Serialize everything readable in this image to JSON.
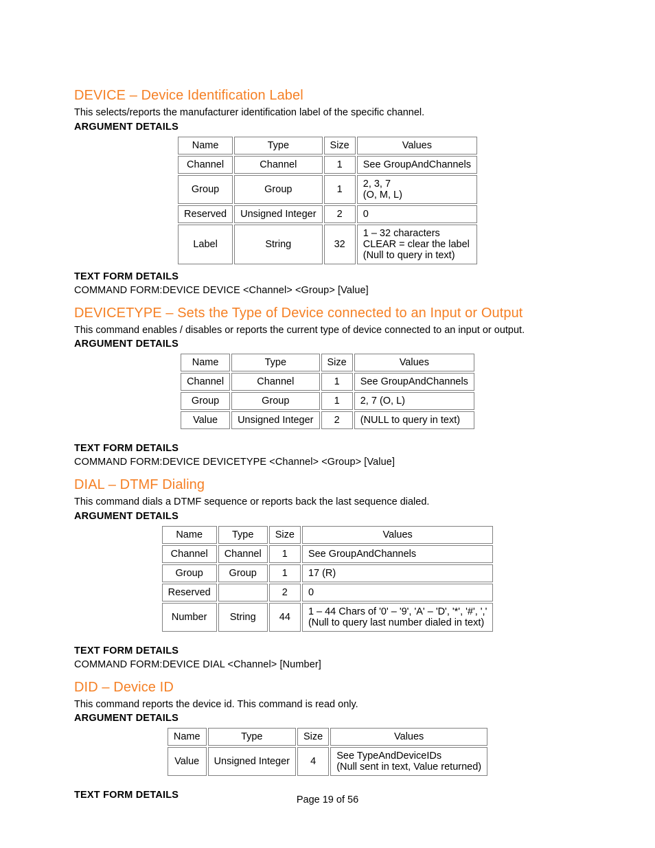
{
  "page_number": "Page 19 of 56",
  "columns": {
    "name": "Name",
    "type": "Type",
    "size": "Size",
    "values": "Values"
  },
  "sections": [
    {
      "id": "device",
      "title": "DEVICE – Device Identification Label",
      "desc": "This selects/reports the manufacturer identification label of the specific channel.",
      "arg_heading": "ARGUMENT DETAILS",
      "rows": [
        {
          "name": "Channel",
          "type": "Channel",
          "size": "1",
          "values": "See GroupAndChannels"
        },
        {
          "name": "Group",
          "type": "Group",
          "size": "1",
          "values": "2, 3, 7\n(O, M, L)"
        },
        {
          "name": "Reserved",
          "type": "Unsigned Integer",
          "size": "2",
          "values": "0"
        },
        {
          "name": "Label",
          "type": "String",
          "size": "32",
          "values": "1 – 32 characters\nCLEAR = clear the label\n(Null to query in text)"
        }
      ],
      "tf_heading": "TEXT FORM DETAILS",
      "tf_line": "COMMAND FORM:DEVICE DEVICE <Channel> <Group> [Value]"
    },
    {
      "id": "devicetype",
      "title": "DEVICETYPE – Sets the Type of Device connected to an Input or Output",
      "desc": "This command enables / disables or reports the current type of device connected to an input or output.",
      "arg_heading": "ARGUMENT DETAILS",
      "rows": [
        {
          "name": "Channel",
          "type": "Channel",
          "size": "1",
          "values": "See GroupAndChannels"
        },
        {
          "name": "Group",
          "type": "Group",
          "size": "1",
          "values": "2, 7 (O, L)"
        },
        {
          "name": "Value",
          "type": "Unsigned Integer",
          "size": "2",
          "values": "(NULL to query in text)"
        }
      ],
      "tf_heading": "TEXT FORM DETAILS",
      "tf_line": "COMMAND FORM:DEVICE DEVICETYPE <Channel> <Group> [Value]"
    },
    {
      "id": "dial",
      "title": "DIAL – DTMF Dialing",
      "desc": "This command dials a DTMF sequence or reports back the last sequence dialed.",
      "arg_heading": "ARGUMENT DETAILS",
      "rows": [
        {
          "name": "Channel",
          "type": "Channel",
          "size": "1",
          "values": "See GroupAndChannels"
        },
        {
          "name": "Group",
          "type": "Group",
          "size": "1",
          "values": "17 (R)"
        },
        {
          "name": "Reserved",
          "type": "",
          "size": "2",
          "values": "0"
        },
        {
          "name": "Number",
          "type": "String",
          "size": "44",
          "values": "1 – 44 Chars of '0' – '9', 'A' – 'D', '*', '#', ','\n(Null to query last number dialed in text)"
        }
      ],
      "tf_heading": "TEXT FORM DETAILS",
      "tf_line": "COMMAND FORM:DEVICE DIAL <Channel> [Number]"
    },
    {
      "id": "did",
      "title": "DID – Device ID",
      "desc": "This command reports the device id. This command is read only.",
      "arg_heading": "ARGUMENT DETAILS",
      "rows": [
        {
          "name": "Value",
          "type": "Unsigned Integer",
          "size": "4",
          "values": "See TypeAndDeviceIDs\n(Null sent in text, Value returned)"
        }
      ],
      "tf_heading": "TEXT FORM DETAILS",
      "tf_line": ""
    }
  ]
}
